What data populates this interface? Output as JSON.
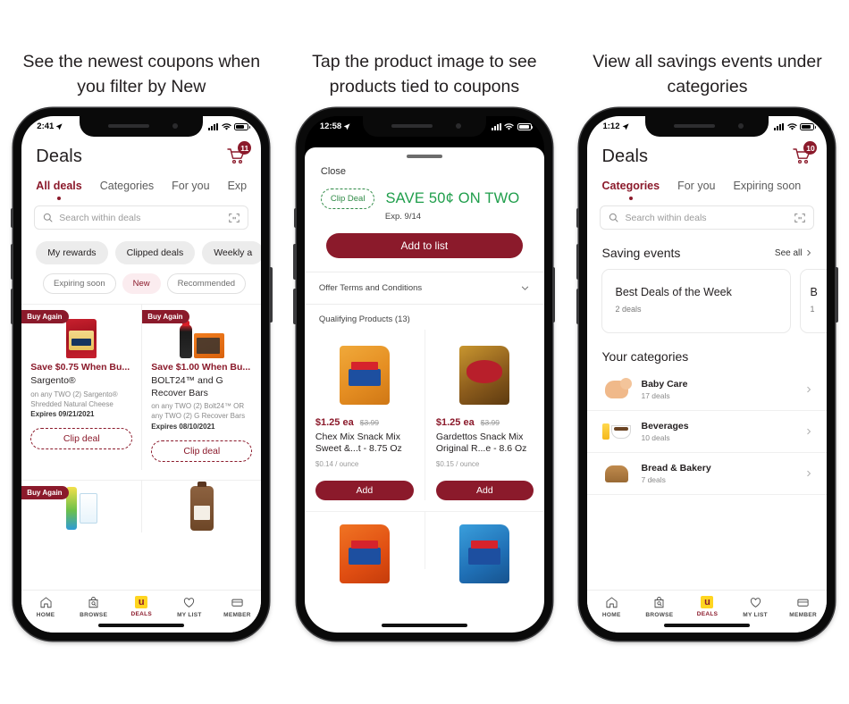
{
  "brand_color": "#8b1a2b",
  "green_color": "#1f9e4b",
  "panels": [
    {
      "headline": "See the newest coupons when you filter by New",
      "status": {
        "time": "2:41",
        "location_icon": "location-arrow-icon"
      }
    },
    {
      "headline": "Tap the product image to see products tied to coupons",
      "status": {
        "time": "12:58",
        "location_icon": "location-arrow-icon"
      }
    },
    {
      "headline": "View all savings events under categories",
      "status": {
        "time": "1:12",
        "location_icon": "location-arrow-icon"
      }
    }
  ],
  "screen1": {
    "title": "Deals",
    "cart_badge": "11",
    "tabs": [
      {
        "label": "All deals",
        "active": true
      },
      {
        "label": "Categories",
        "active": false
      },
      {
        "label": "For you",
        "active": false
      },
      {
        "label": "Exp",
        "active": false
      }
    ],
    "search_placeholder": "Search within deals",
    "chips": [
      "My rewards",
      "Clipped deals",
      "Weekly a"
    ],
    "filter_chips": [
      {
        "label": "Expiring soon",
        "selected": false
      },
      {
        "label": "New",
        "selected": true
      },
      {
        "label": "Recommended",
        "selected": false
      }
    ],
    "coupons": [
      {
        "badge": "Buy Again",
        "save": "Save $0.75 When Bu...",
        "brand": "Sargento®",
        "desc": "on any TWO (2) Sargento® Shredded Natural Cheese",
        "expires": "Expires 09/21/2021",
        "clip_label": "Clip deal"
      },
      {
        "badge": "Buy Again",
        "save": "Save $1.00 When Bu...",
        "brand": "BOLT24™ and G Recover Bars",
        "desc": "on any TWO (2) Bolt24™ OR any TWO (2) G Recover Bars",
        "expires": "Expires 08/10/2021",
        "clip_label": "Clip deal"
      }
    ],
    "coupons_row2": [
      {
        "badge": "Buy Again"
      },
      {
        "badge": ""
      }
    ],
    "bottom_nav": [
      {
        "label": "HOME",
        "icon": "home-icon",
        "active": false
      },
      {
        "label": "BROWSE",
        "icon": "browse-bag-icon",
        "active": false
      },
      {
        "label": "DEALS",
        "icon": "u-logo-icon",
        "active": true
      },
      {
        "label": "MY LIST",
        "icon": "heart-icon",
        "active": false
      },
      {
        "label": "MEMBER",
        "icon": "card-icon",
        "active": false
      }
    ]
  },
  "screen2": {
    "close_label": "Close",
    "clip_deal_label": "Clip Deal",
    "save_headline": "SAVE 50¢ ON TWO",
    "exp_label": "Exp. 9/14",
    "add_to_list_label": "Add to list",
    "terms_label": "Offer Terms and Conditions",
    "qualifying_label": "Qualifying Products (13)",
    "products": [
      {
        "price_now": "$1.25 ea",
        "price_was": "$3.99",
        "name": "Chex Mix Snack Mix Sweet &...t - 8.75 Oz",
        "unit": "$0.14 / ounce",
        "add_label": "Add"
      },
      {
        "price_now": "$1.25 ea",
        "price_was": "$3.99",
        "name": "Gardettos Snack Mix Original R...e - 8.6 Oz",
        "unit": "$0.15 / ounce",
        "add_label": "Add"
      }
    ]
  },
  "screen3": {
    "title": "Deals",
    "cart_badge": "10",
    "tabs": [
      {
        "label": "Categories",
        "active": true
      },
      {
        "label": "For you",
        "active": false
      },
      {
        "label": "Expiring soon",
        "active": false
      }
    ],
    "search_placeholder": "Search within deals",
    "saving_events_title": "Saving events",
    "see_all_label": "See all",
    "events": [
      {
        "title": "Best Deals of the Week",
        "sub": "2 deals"
      },
      {
        "title": "B",
        "sub": "1"
      }
    ],
    "your_categories_title": "Your categories",
    "categories": [
      {
        "name": "Baby Care",
        "count": "17 deals",
        "icon": "baby-icon"
      },
      {
        "name": "Beverages",
        "count": "10 deals",
        "icon": "beverage-icon"
      },
      {
        "name": "Bread & Bakery",
        "count": "7 deals",
        "icon": "bread-icon"
      }
    ],
    "bottom_nav": [
      {
        "label": "HOME",
        "icon": "home-icon",
        "active": false
      },
      {
        "label": "BROWSE",
        "icon": "browse-bag-icon",
        "active": false
      },
      {
        "label": "DEALS",
        "icon": "u-logo-icon",
        "active": true
      },
      {
        "label": "MY LIST",
        "icon": "heart-icon",
        "active": false
      },
      {
        "label": "MEMBER",
        "icon": "card-icon",
        "active": false
      }
    ]
  }
}
